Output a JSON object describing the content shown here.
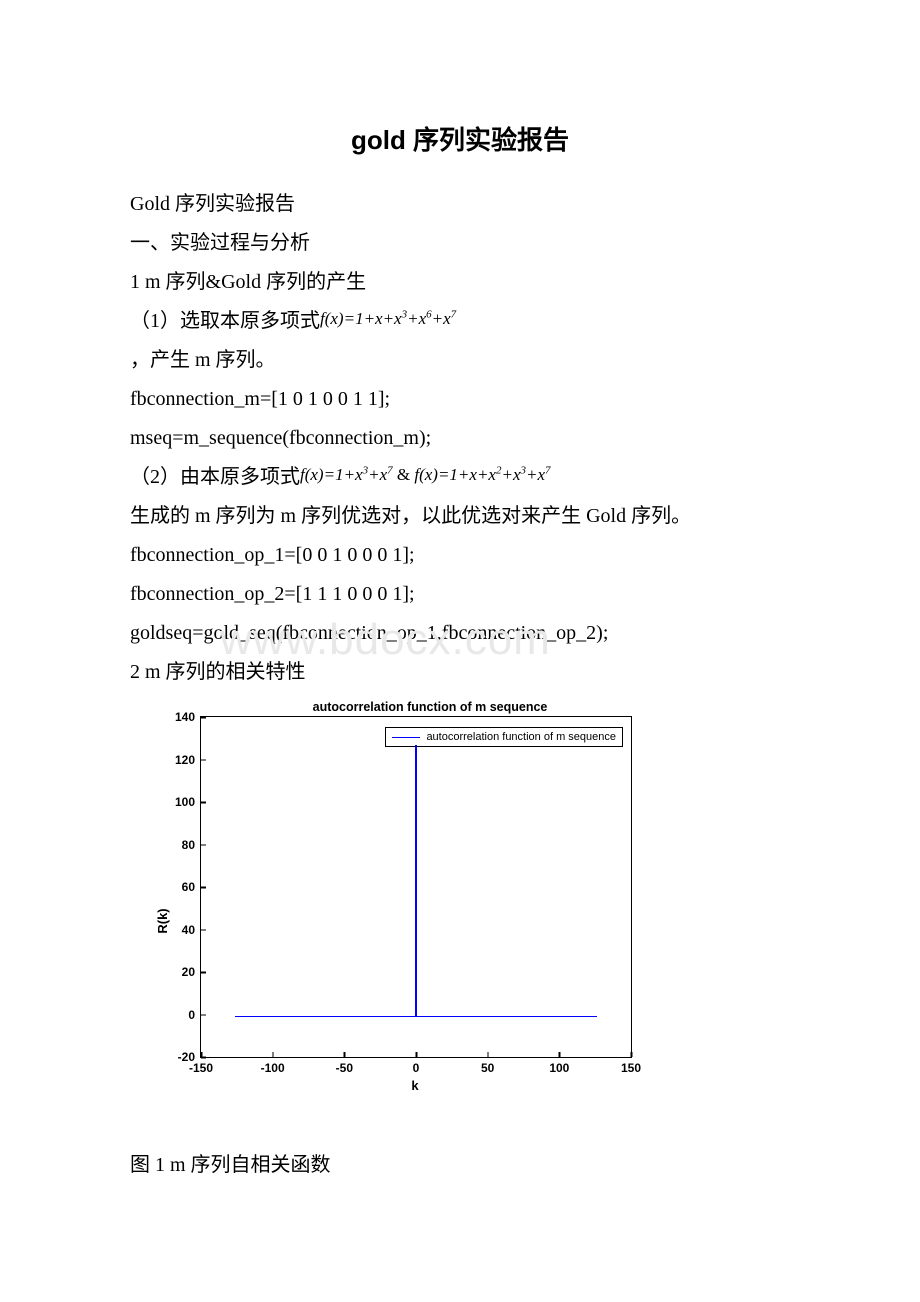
{
  "title": "gold 序列实验报告",
  "lines": {
    "l1": "Gold 序列实验报告",
    "l2": "一、实验过程与分析",
    "l3": "1 m 序列&Gold 序列的产生",
    "l4_pre": "（1）选取本原多项式",
    "l4_formula": "f(x)=1+x+x³+x⁶+x⁷",
    "l5": "，产生 m 序列。",
    "l6": "fbconnection_m=[1 0 1 0 0 1 1];",
    "l7": "mseq=m_sequence(fbconnection_m);",
    "l8_pre": "（2）由本原多项式",
    "l8_formula1": "f(x)=1+x³+x⁷",
    "l8_amp": "  &  ",
    "l8_formula2": "f(x)=1+x+x²+x³+x⁷",
    "l9": "生成的 m 序列为 m 序列优选对，以此优选对来产生 Gold 序列。",
    "l10": "fbconnection_op_1=[0 0 1 0 0 0 1];",
    "l11": "fbconnection_op_2=[1 1 1 0 0 0 1];",
    "l12": "goldseq=gold_seq(fbconnection_op_1,fbconnection_op_2);",
    "l13": "2 m 序列的相关特性"
  },
  "watermark": "www.bdocx.com",
  "chart_data": {
    "type": "line",
    "title": "autocorrelation function of m sequence",
    "legend": "autocorrelation function of m sequence",
    "xlabel": "k",
    "ylabel": "R(k)",
    "xlim": [
      -150,
      150
    ],
    "ylim": [
      -20,
      140
    ],
    "xticks": [
      -150,
      -100,
      -50,
      0,
      50,
      100,
      150
    ],
    "yticks": [
      -20,
      0,
      20,
      40,
      60,
      80,
      100,
      120,
      140
    ],
    "data_note": "autocorrelation of an m-sequence of length 127: R(0)=127, R(k)=-1 for k in [-126,...,-1,1,...,126]",
    "peak_x": 0,
    "peak_y": 127,
    "baseline_y": -1,
    "baseline_xmin": -126,
    "baseline_xmax": 126
  },
  "caption": "图 1 m 序列自相关函数"
}
